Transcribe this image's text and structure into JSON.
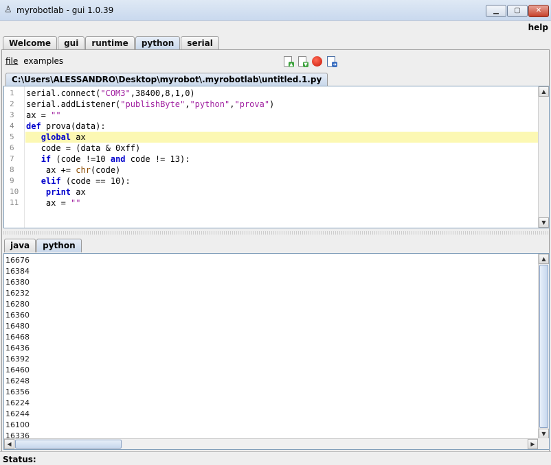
{
  "window": {
    "title": "myrobotlab - gui 1.0.39",
    "app_icon": "robot-icon",
    "controls": [
      "minimize-icon",
      "maximize-icon",
      "close-icon"
    ]
  },
  "menubar": {
    "help_label": "help"
  },
  "top_tabs": [
    {
      "label": "Welcome",
      "active": false
    },
    {
      "label": "gui",
      "active": false
    },
    {
      "label": "runtime",
      "active": false
    },
    {
      "label": "python",
      "active": true
    },
    {
      "label": "serial",
      "active": false
    }
  ],
  "python_menu": {
    "file_label": "file",
    "examples_label": "examples"
  },
  "toolbar": [
    "new-file-icon",
    "open-file-icon",
    "stop-icon",
    "save-file-icon"
  ],
  "file_tab": {
    "label": "C:\\Users\\ALESSANDRO\\Desktop\\myrobot\\.myrobotlab\\untitled.1.py"
  },
  "editor": {
    "highlighted_line": 5,
    "lines": [
      "serial.connect(\"COM3\",38400,8,1,0)",
      "serial.addListener(\"publishByte\",\"python\",\"prova\")",
      "ax = \"\"",
      "def prova(data):",
      "   global ax",
      "   code = (data & 0xff)",
      "   if (code !=10 and code != 13):",
      "    ax += chr(code)",
      "   elif (code == 10):",
      "    print ax",
      "    ax = \"\""
    ],
    "line_numbers": [
      "1",
      "2",
      "3",
      "4",
      "5",
      "6",
      "7",
      "8",
      "9",
      "10",
      "11"
    ]
  },
  "bottom_tabs": [
    {
      "label": "java",
      "active": false
    },
    {
      "label": "python",
      "active": true
    }
  ],
  "output_lines": [
    "16676",
    "16384",
    "16380",
    "16232",
    "16280",
    "16360",
    "16480",
    "16468",
    "16436",
    "16392",
    "16460",
    "16248",
    "16356",
    "16224",
    "16244",
    "16100",
    "16336"
  ],
  "status": {
    "label": "Status:"
  }
}
